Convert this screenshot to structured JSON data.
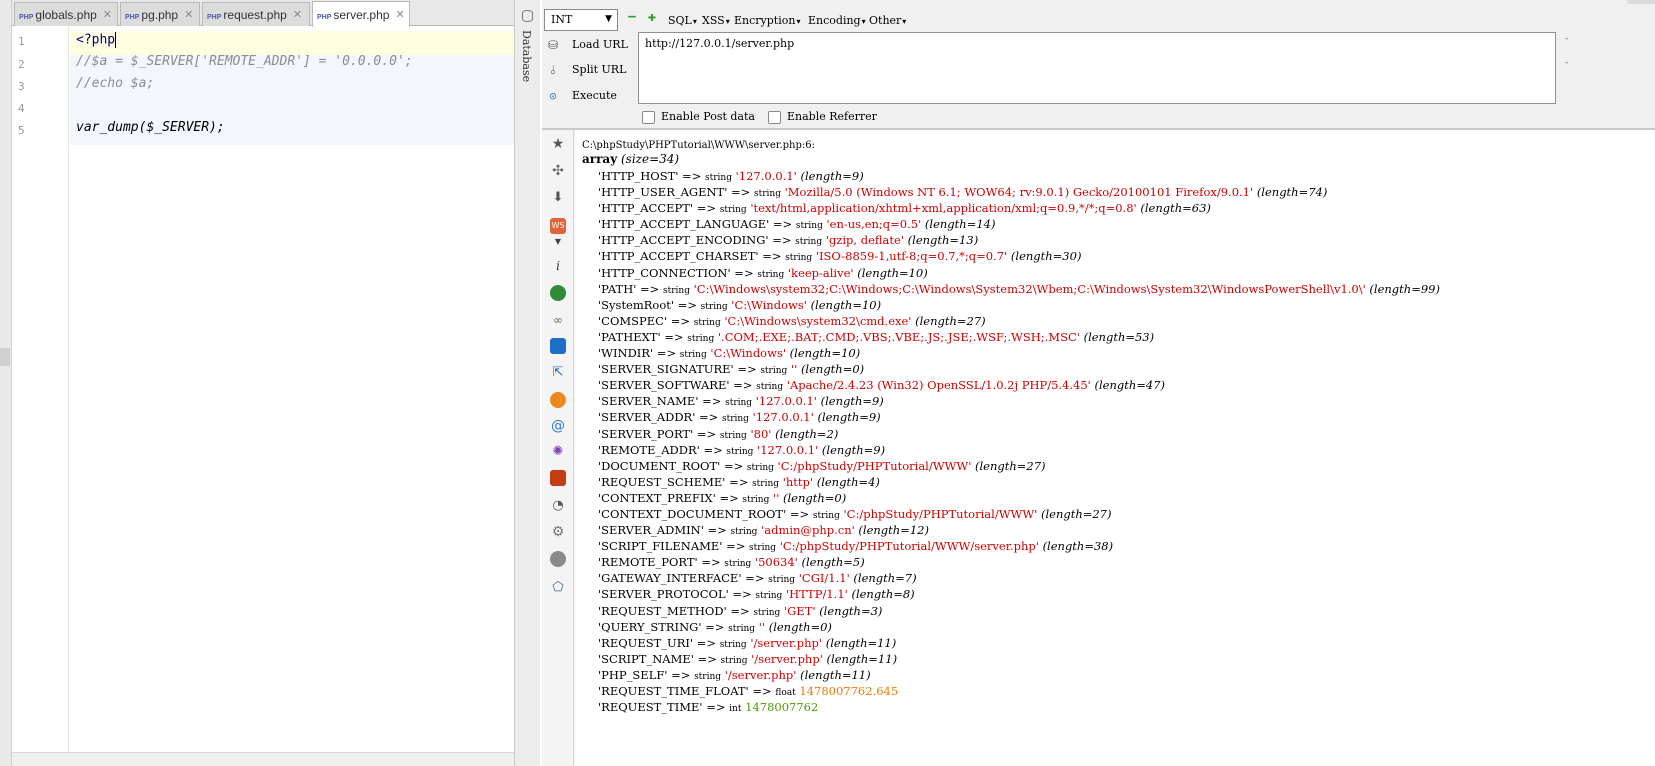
{
  "editor": {
    "tabs": [
      {
        "icon": "PHP",
        "name": "globals.php",
        "active": false
      },
      {
        "icon": "PHP",
        "name": "pg.php",
        "active": false
      },
      {
        "icon": "PHP",
        "name": "request.php",
        "active": false
      },
      {
        "icon": "PHP",
        "name": "server.php",
        "active": true
      }
    ],
    "line_numbers": [
      "1",
      "2",
      "3",
      "4",
      "5"
    ],
    "lines": [
      "<?php",
      "//$a = $_SERVER['REMOTE_ADDR'] = '0.0.0.0';",
      "//echo $a;",
      "",
      "var_dump($_SERVER);"
    ],
    "side_label": "Database"
  },
  "hackbar": {
    "type_select": "INT",
    "menus": [
      "SQL",
      "XSS",
      "Encryption",
      "Encoding",
      "Other"
    ],
    "actions": [
      {
        "label": "Load URL",
        "icon": "load-icon"
      },
      {
        "label": "Split URL",
        "icon": "split-icon"
      },
      {
        "label": "Execute",
        "icon": "execute-icon"
      }
    ],
    "url": "http://127.0.0.1/server.php",
    "checkboxes": [
      {
        "label": "Enable Post data",
        "checked": false
      },
      {
        "label": "Enable Referrer",
        "checked": false
      }
    ]
  },
  "sidebar_icons": [
    "star-icon",
    "puzzle-icon",
    "download-icon",
    "ws-icon",
    "info-icon",
    "green-ball-icon",
    "binoculars-icon",
    "database-icon",
    "cursor-icon",
    "fox-icon",
    "swirl-icon",
    "bug-icon",
    "red-box-icon",
    "palette-icon",
    "gear-icon",
    "globe-icon",
    "eraser-icon"
  ],
  "output": {
    "path": "C:\\phpStudy\\PHPTutorial\\WWW\\server.php:6:",
    "array_label": "array",
    "size_label": "(size=34)",
    "rows": [
      {
        "key": "'HTTP_HOST'",
        "type": "string",
        "value": "'127.0.0.1'",
        "kind": "s",
        "len": "(length=9)"
      },
      {
        "key": "'HTTP_USER_AGENT'",
        "type": "string",
        "value": "'Mozilla/5.0 (Windows NT 6.1; WOW64; rv:9.0.1) Gecko/20100101 Firefox/9.0.1'",
        "kind": "s",
        "len": "(length=74)"
      },
      {
        "key": "'HTTP_ACCEPT'",
        "type": "string",
        "value": "'text/html,application/xhtml+xml,application/xml;q=0.9,*/*;q=0.8'",
        "kind": "s",
        "len": "(length=63)"
      },
      {
        "key": "'HTTP_ACCEPT_LANGUAGE'",
        "type": "string",
        "value": "'en-us,en;q=0.5'",
        "kind": "s",
        "len": "(length=14)"
      },
      {
        "key": "'HTTP_ACCEPT_ENCODING'",
        "type": "string",
        "value": "'gzip, deflate'",
        "kind": "s",
        "len": "(length=13)"
      },
      {
        "key": "'HTTP_ACCEPT_CHARSET'",
        "type": "string",
        "value": "'ISO-8859-1,utf-8;q=0.7,*;q=0.7'",
        "kind": "s",
        "len": "(length=30)"
      },
      {
        "key": "'HTTP_CONNECTION'",
        "type": "string",
        "value": "'keep-alive'",
        "kind": "s",
        "len": "(length=10)"
      },
      {
        "key": "'PATH'",
        "type": "string",
        "value": "'C:\\Windows\\system32;C:\\Windows;C:\\Windows\\System32\\Wbem;C:\\Windows\\System32\\WindowsPowerShell\\v1.0\\'",
        "kind": "s",
        "len": "(length=99)"
      },
      {
        "key": "'SystemRoot'",
        "type": "string",
        "value": "'C:\\Windows'",
        "kind": "s",
        "len": "(length=10)"
      },
      {
        "key": "'COMSPEC'",
        "type": "string",
        "value": "'C:\\Windows\\system32\\cmd.exe'",
        "kind": "s",
        "len": "(length=27)"
      },
      {
        "key": "'PATHEXT'",
        "type": "string",
        "value": "'.COM;.EXE;.BAT;.CMD;.VBS;.VBE;.JS;.JSE;.WSF;.WSH;.MSC'",
        "kind": "s",
        "len": "(length=53)"
      },
      {
        "key": "'WINDIR'",
        "type": "string",
        "value": "'C:\\Windows'",
        "kind": "s",
        "len": "(length=10)"
      },
      {
        "key": "'SERVER_SIGNATURE'",
        "type": "string",
        "value": "''",
        "kind": "s",
        "len": "(length=0)"
      },
      {
        "key": "'SERVER_SOFTWARE'",
        "type": "string",
        "value": "'Apache/2.4.23 (Win32) OpenSSL/1.0.2j PHP/5.4.45'",
        "kind": "s",
        "len": "(length=47)"
      },
      {
        "key": "'SERVER_NAME'",
        "type": "string",
        "value": "'127.0.0.1'",
        "kind": "s",
        "len": "(length=9)"
      },
      {
        "key": "'SERVER_ADDR'",
        "type": "string",
        "value": "'127.0.0.1'",
        "kind": "s",
        "len": "(length=9)"
      },
      {
        "key": "'SERVER_PORT'",
        "type": "string",
        "value": "'80'",
        "kind": "s",
        "len": "(length=2)"
      },
      {
        "key": "'REMOTE_ADDR'",
        "type": "string",
        "value": "'127.0.0.1'",
        "kind": "s",
        "len": "(length=9)"
      },
      {
        "key": "'DOCUMENT_ROOT'",
        "type": "string",
        "value": "'C:/phpStudy/PHPTutorial/WWW'",
        "kind": "s",
        "len": "(length=27)"
      },
      {
        "key": "'REQUEST_SCHEME'",
        "type": "string",
        "value": "'http'",
        "kind": "s",
        "len": "(length=4)"
      },
      {
        "key": "'CONTEXT_PREFIX'",
        "type": "string",
        "value": "''",
        "kind": "s",
        "len": "(length=0)"
      },
      {
        "key": "'CONTEXT_DOCUMENT_ROOT'",
        "type": "string",
        "value": "'C:/phpStudy/PHPTutorial/WWW'",
        "kind": "s",
        "len": "(length=27)"
      },
      {
        "key": "'SERVER_ADMIN'",
        "type": "string",
        "value": "'admin@php.cn'",
        "kind": "s",
        "len": "(length=12)"
      },
      {
        "key": "'SCRIPT_FILENAME'",
        "type": "string",
        "value": "'C:/phpStudy/PHPTutorial/WWW/server.php'",
        "kind": "s",
        "len": "(length=38)"
      },
      {
        "key": "'REMOTE_PORT'",
        "type": "string",
        "value": "'50634'",
        "kind": "s",
        "len": "(length=5)"
      },
      {
        "key": "'GATEWAY_INTERFACE'",
        "type": "string",
        "value": "'CGI/1.1'",
        "kind": "s",
        "len": "(length=7)"
      },
      {
        "key": "'SERVER_PROTOCOL'",
        "type": "string",
        "value": "'HTTP/1.1'",
        "kind": "s",
        "len": "(length=8)"
      },
      {
        "key": "'REQUEST_METHOD'",
        "type": "string",
        "value": "'GET'",
        "kind": "s",
        "len": "(length=3)"
      },
      {
        "key": "'QUERY_STRING'",
        "type": "string",
        "value": "''",
        "kind": "s",
        "len": "(length=0)"
      },
      {
        "key": "'REQUEST_URI'",
        "type": "string",
        "value": "'/server.php'",
        "kind": "s",
        "len": "(length=11)"
      },
      {
        "key": "'SCRIPT_NAME'",
        "type": "string",
        "value": "'/server.php'",
        "kind": "s",
        "len": "(length=11)"
      },
      {
        "key": "'PHP_SELF'",
        "type": "string",
        "value": "'/server.php'",
        "kind": "s",
        "len": "(length=11)"
      },
      {
        "key": "'REQUEST_TIME_FLOAT'",
        "type": "float",
        "value": "1478007762.645",
        "kind": "f",
        "len": ""
      },
      {
        "key": "'REQUEST_TIME'",
        "type": "int",
        "value": "1478007762",
        "kind": "n",
        "len": ""
      }
    ]
  },
  "colors": {
    "string_value": "#cc0000",
    "float_value": "#f57900",
    "int_value": "#4e9a06",
    "comment": "#8c8c8c",
    "php_tag": "#000080",
    "current_line": "#fefde0",
    "ok_check": "#3fa33f"
  }
}
